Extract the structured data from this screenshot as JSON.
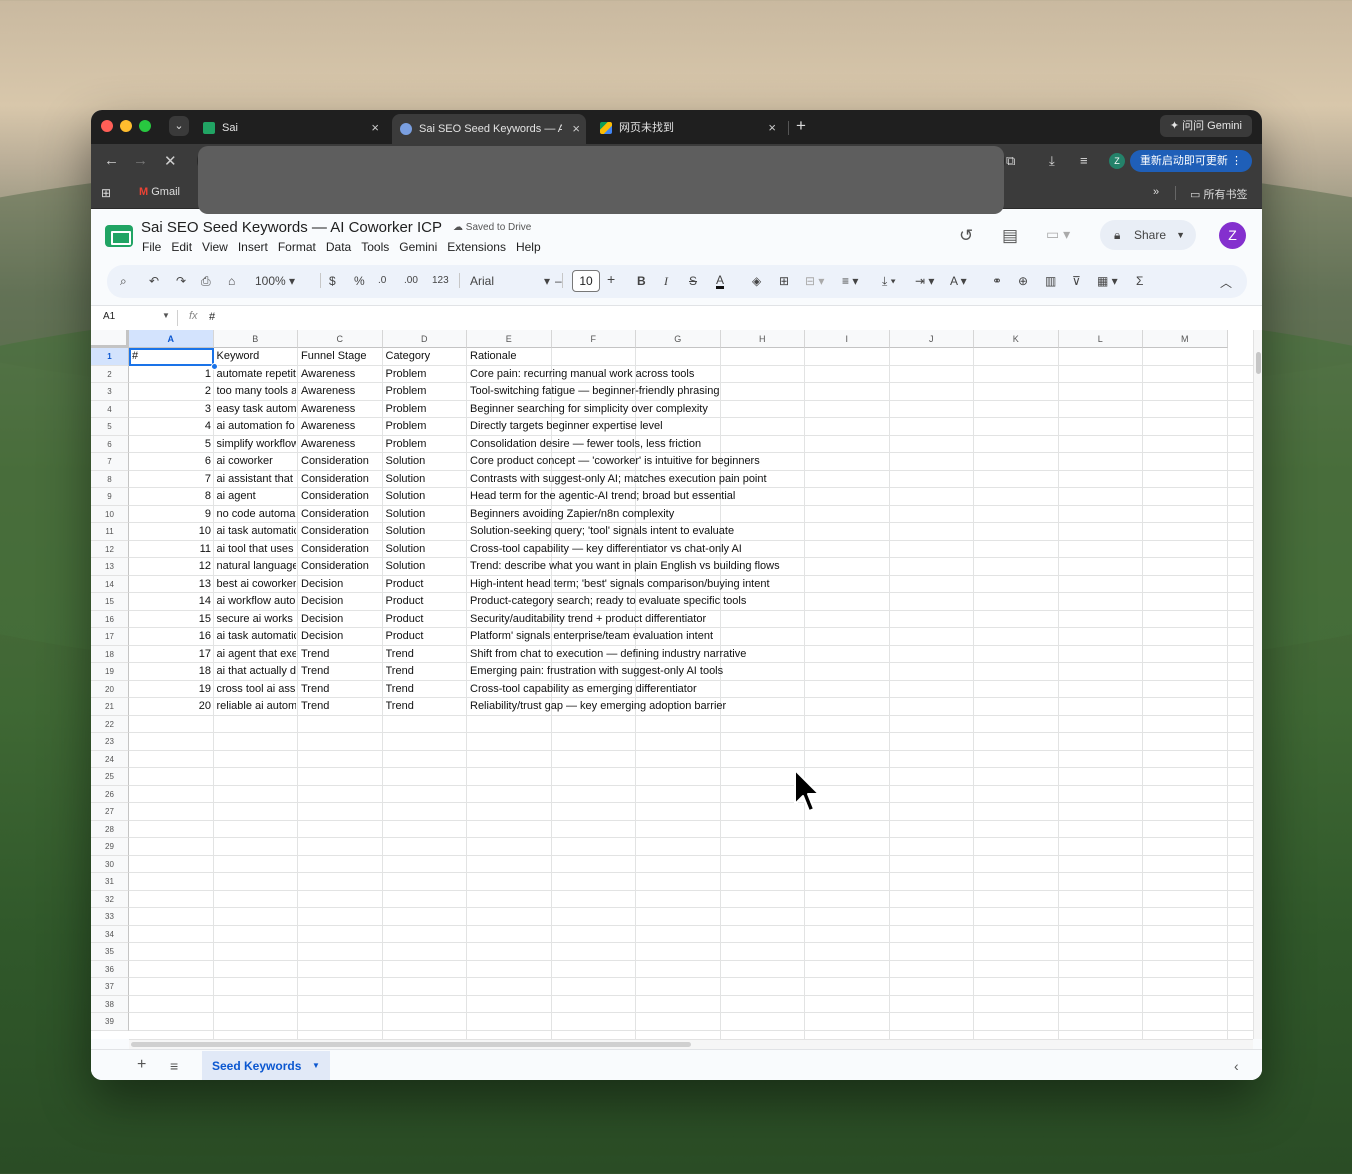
{
  "browser": {
    "tabs": [
      {
        "title": "Sai",
        "favicon_color": "#21a464"
      },
      {
        "title": "Sai SEO Seed Keywords — AI Coworker ICP",
        "favicon_color": "#7a9fe0"
      },
      {
        "title": "网页未找到",
        "favicon_color": "#fbbc04"
      }
    ],
    "gemini_button": "问问 Gemini",
    "update_button": "重新启动即可更新",
    "profile_initial": "Z",
    "bookmarks": {
      "gmail": "Gmail",
      "all_bookmarks": "所有书签",
      "overflow": "»"
    }
  },
  "doc": {
    "title": "Sai SEO Seed Keywords — AI Coworker ICP",
    "saved_status": "Saved to Drive",
    "menus": [
      "File",
      "Edit",
      "View",
      "Insert",
      "Format",
      "Data",
      "Tools",
      "Gemini",
      "Extensions",
      "Help"
    ],
    "share_label": "Share",
    "user_initial": "Z"
  },
  "format_toolbar": {
    "zoom": "100%",
    "currency": "$",
    "percent": "%",
    "decrease_decimal": ".0",
    "increase_decimal": ".00",
    "number_format": "123",
    "font": "Arial",
    "font_size": "10"
  },
  "formula_bar": {
    "cell_ref": "A1",
    "fx": "fx",
    "value": "#"
  },
  "sheet": {
    "columns": [
      "A",
      "B",
      "C",
      "D",
      "E",
      "F",
      "G",
      "H",
      "I",
      "J",
      "K",
      "L",
      "M"
    ],
    "selected_cell": "A1",
    "row_count_visible": 39,
    "header": {
      "a": "#",
      "b": "Keyword",
      "c": "Funnel Stage",
      "d": "Category",
      "e": "Rationale"
    },
    "rows": [
      {
        "a": "1",
        "b": "automate repetit",
        "c": "Awareness",
        "d": "Problem",
        "e": "Core pain: recurring manual work across tools"
      },
      {
        "a": "2",
        "b": "too many tools a",
        "c": "Awareness",
        "d": "Problem",
        "e": "Tool-switching fatigue — beginner-friendly phrasing"
      },
      {
        "a": "3",
        "b": "easy task autom",
        "c": "Awareness",
        "d": "Problem",
        "e": "Beginner searching for simplicity over complexity"
      },
      {
        "a": "4",
        "b": "ai automation fo",
        "c": "Awareness",
        "d": "Problem",
        "e": "Directly targets beginner expertise level"
      },
      {
        "a": "5",
        "b": "simplify workflow",
        "c": "Awareness",
        "d": "Problem",
        "e": "Consolidation desire — fewer tools, less friction"
      },
      {
        "a": "6",
        "b": "ai coworker",
        "c": "Consideration",
        "d": "Solution",
        "e": "Core product concept — 'coworker' is intuitive for beginners"
      },
      {
        "a": "7",
        "b": "ai assistant that",
        "c": "Consideration",
        "d": "Solution",
        "e": "Contrasts with suggest-only AI; matches execution pain point"
      },
      {
        "a": "8",
        "b": "ai agent",
        "c": "Consideration",
        "d": "Solution",
        "e": "Head term for the agentic-AI trend; broad but essential"
      },
      {
        "a": "9",
        "b": "no code automa",
        "c": "Consideration",
        "d": "Solution",
        "e": "Beginners avoiding Zapier/n8n complexity"
      },
      {
        "a": "10",
        "b": "ai task automatic",
        "c": "Consideration",
        "d": "Solution",
        "e": "Solution-seeking query; 'tool' signals intent to evaluate"
      },
      {
        "a": "11",
        "b": "ai tool that uses",
        "c": "Consideration",
        "d": "Solution",
        "e": "Cross-tool capability — key differentiator vs chat-only AI"
      },
      {
        "a": "12",
        "b": "natural language",
        "c": "Consideration",
        "d": "Solution",
        "e": "Trend: describe what you want in plain English vs building flows"
      },
      {
        "a": "13",
        "b": "best ai coworker",
        "c": "Decision",
        "d": "Product",
        "e": "High-intent head term; 'best' signals comparison/buying intent"
      },
      {
        "a": "14",
        "b": "ai workflow auto",
        "c": "Decision",
        "d": "Product",
        "e": "Product-category search; ready to evaluate specific tools"
      },
      {
        "a": "15",
        "b": "secure ai works",
        "c": "Decision",
        "d": "Product",
        "e": "Security/auditability trend + product differentiator"
      },
      {
        "a": "16",
        "b": "ai task automatic",
        "c": "Decision",
        "d": "Product",
        "e": "Platform' signals enterprise/team evaluation intent"
      },
      {
        "a": "17",
        "b": "ai agent that exe",
        "c": "Trend",
        "d": "Trend",
        "e": "Shift from chat to execution — defining industry narrative"
      },
      {
        "a": "18",
        "b": "ai that actually d",
        "c": "Trend",
        "d": "Trend",
        "e": "Emerging pain: frustration with suggest-only AI tools"
      },
      {
        "a": "19",
        "b": "cross tool ai ass",
        "c": "Trend",
        "d": "Trend",
        "e": "Cross-tool capability as emerging differentiator"
      },
      {
        "a": "20",
        "b": "reliable ai autom",
        "c": "Trend",
        "d": "Trend",
        "e": "Reliability/trust gap — key emerging adoption barrier"
      }
    ]
  },
  "sheet_tabs": {
    "active": "Seed Keywords"
  }
}
